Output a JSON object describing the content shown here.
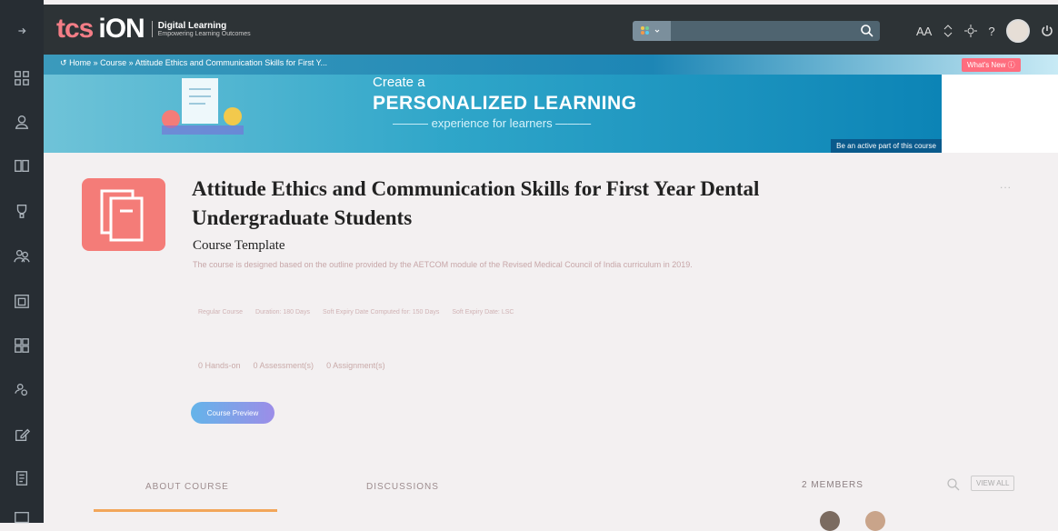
{
  "app": {
    "logo_main_a": "tcs",
    "logo_main_b": "iON",
    "logo_sub_line1": "Digital Learning",
    "logo_sub_line2": "Empowering Learning Outcomes"
  },
  "topbar": {
    "search_placeholder": "",
    "icons": [
      "apps-grid-icon",
      "search-icon",
      "font-size-icon",
      "sort-icon",
      "settings-icon",
      "help-icon",
      "avatar",
      "power-icon"
    ],
    "font_label": "AA",
    "help_label": "?"
  },
  "breadcrumb": {
    "home": "Home",
    "sep": "»",
    "course": "Course",
    "current": "Attitude Ethics and Communication Skills for First Y..."
  },
  "whats_new": "What's New",
  "banner": {
    "line1": "Create a",
    "line2": "PERSONALIZED LEARNING",
    "line3": "——— experience for learners ———",
    "cta": "Be an active part of this course"
  },
  "course": {
    "title": "Attitude Ethics and Communication Skills for First Year Dental Undergraduate Students",
    "subtitle": "Course Template",
    "description": "The course is designed based on the outline provided by the AETCOM module of the Revised Medical Council of India curriculum in 2019.",
    "meta": [
      "Regular Course",
      "Duration: 180 Days",
      "Soft Expiry Date Computed for: 150 Days",
      "Soft Expiry Date: LSC"
    ],
    "counts": [
      "0 Hands-on",
      "0 Assessment(s)",
      "0 Assignment(s)"
    ],
    "preview_label": "Course Preview",
    "more": "..."
  },
  "tabs": {
    "about": "ABOUT COURSE",
    "discussions": "DISCUSSIONS"
  },
  "members": {
    "label": "2 MEMBERS",
    "view_all": "VIEW ALL"
  },
  "colors": {
    "sidebar": "#272d33",
    "topbar": "#2d3336",
    "accent_pink": "#ff6d7e",
    "banner_blue": "#1d86b5",
    "thumb_coral": "#f47c78",
    "tab_underline": "#f2a65a"
  },
  "sidebar_icons": [
    "collapse-arrow-icon",
    "dashboard-icon",
    "user-icon",
    "book-icon",
    "trophy-icon",
    "users-icon",
    "calendar-icon",
    "grid-icon",
    "groups-icon",
    "edit-icon",
    "document-icon",
    "id-card-icon"
  ]
}
